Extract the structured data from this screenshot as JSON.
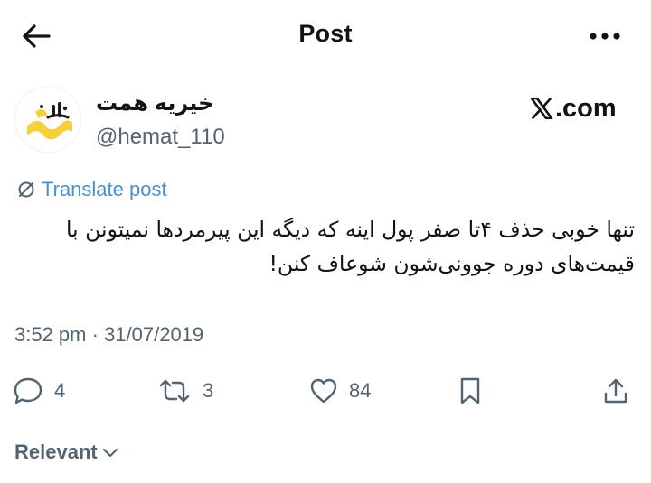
{
  "header": {
    "title": "Post"
  },
  "author": {
    "name": "خیریه همت",
    "handle": "@hemat_110"
  },
  "source": {
    "label": ".com"
  },
  "translate": {
    "label": "Translate post"
  },
  "post": {
    "text": "تنها خوبی حذف ۴تا صفر پول اینه که دیگه این پیرمردها نمیتونن با قیمت‌های دوره جوونی‌شون شوعاف کنن!"
  },
  "meta": {
    "time": "3:52 pm",
    "separator": " · ",
    "date": "31/07/2019"
  },
  "actions": {
    "replies": "4",
    "reposts": "3",
    "likes": "84"
  },
  "filter": {
    "label": "Relevant"
  },
  "colors": {
    "text": "#0f1419",
    "muted": "#536471",
    "link": "#4a8fc8",
    "avatar_accent": "#f4d03f"
  }
}
